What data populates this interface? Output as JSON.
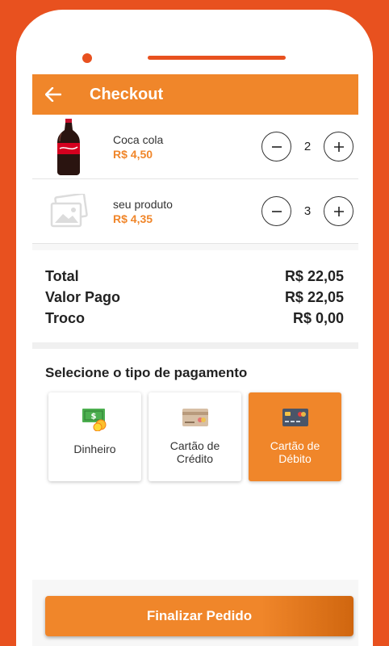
{
  "header": {
    "title": "Checkout"
  },
  "cart": {
    "items": [
      {
        "name": "Coca cola",
        "price": "R$ 4,50",
        "qty": "2"
      },
      {
        "name": "seu produto",
        "price": "R$ 4,35",
        "qty": "3"
      }
    ],
    "minus": "−",
    "plus": "+"
  },
  "totals": {
    "total_label": "Total",
    "total_value": "R$ 22,05",
    "paid_label": "Valor Pago",
    "paid_value": "R$ 22,05",
    "change_label": "Troco",
    "change_value": "R$ 0,00"
  },
  "payment": {
    "title": "Selecione o tipo de pagamento",
    "options": [
      {
        "label": "Dinheiro",
        "icon": "cash-icon",
        "selected": false
      },
      {
        "label": "Cartão de Crédito",
        "icon": "credit-card-icon",
        "selected": false
      },
      {
        "label": "Cartão de Débito",
        "icon": "debit-card-icon",
        "selected": true
      }
    ]
  },
  "action": {
    "finish_label": "Finalizar Pedido"
  },
  "colors": {
    "accent": "#f0862a",
    "background": "#e8511f"
  }
}
